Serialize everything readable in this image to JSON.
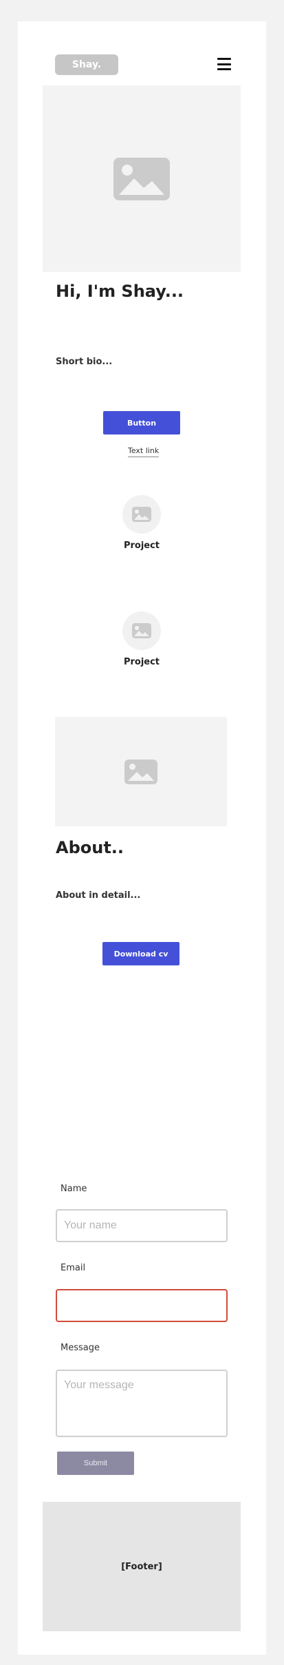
{
  "header": {
    "logo_text": "Shay.",
    "menu_icon": "hamburger-icon"
  },
  "hero": {
    "image_icon": "image-placeholder-icon",
    "title": "Hi, I'm Shay...",
    "bio": "Short bio...",
    "button_label": "Button",
    "link_label": "Text link"
  },
  "projects": [
    {
      "label": "Project",
      "icon": "image-placeholder-icon"
    },
    {
      "label": "Project",
      "icon": "image-placeholder-icon"
    }
  ],
  "about": {
    "image_icon": "image-placeholder-icon",
    "title": "About..",
    "detail": "About in detail...",
    "button_label": "Download cv"
  },
  "contact_form": {
    "name_label": "Name",
    "name_placeholder": "Your name",
    "email_label": "Email",
    "email_placeholder": "",
    "message_label": "Message",
    "message_placeholder": "Your message",
    "submit_label": "Submit"
  },
  "footer": {
    "text": "[Footer]"
  },
  "colors": {
    "accent": "#4450d8",
    "error_border": "#d34a3a",
    "submit_bg": "#8c89a3"
  }
}
